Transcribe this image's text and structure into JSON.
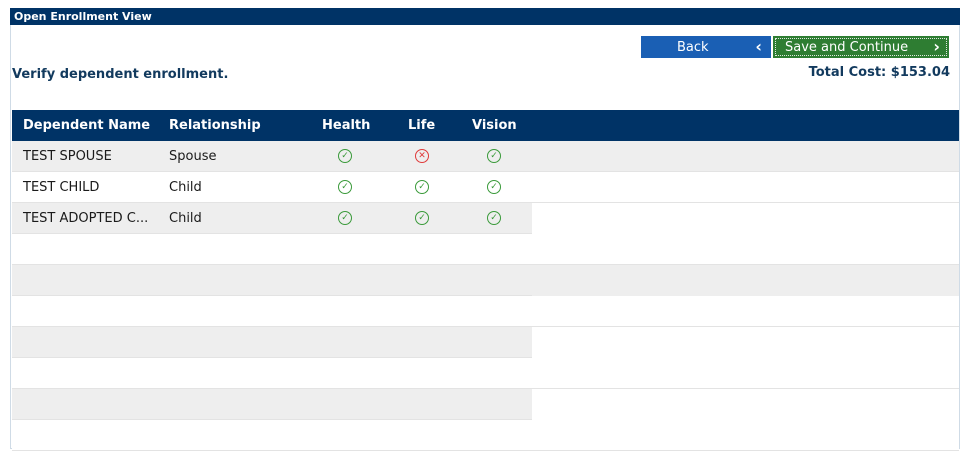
{
  "window": {
    "title": "Open Enrollment View"
  },
  "header": {
    "instruction": "Verify dependent enrollment.",
    "total_cost": "Total Cost: $153.04"
  },
  "buttons": {
    "back_label": "Back",
    "save_label": "Save and Continue"
  },
  "table": {
    "columns": [
      "Dependent Name",
      "Relationship",
      "Health",
      "Life",
      "Vision"
    ],
    "rows": [
      {
        "name": "TEST SPOUSE",
        "relationship": "Spouse",
        "health": "check",
        "life": "x",
        "vision": "check"
      },
      {
        "name": "TEST CHILD",
        "relationship": "Child",
        "health": "check",
        "life": "check",
        "vision": "check"
      },
      {
        "name": "TEST ADOPTED C...",
        "relationship": "Child",
        "health": "check",
        "life": "check",
        "vision": "check"
      }
    ],
    "empty_row_count": 7
  },
  "icons": {
    "check": "check-circle-icon",
    "x": "x-circle-icon",
    "chevron": "chevron-left-icon / chevron-right-icon"
  },
  "colors": {
    "header_bg": "#003366",
    "back_button": "#1a5fb4",
    "save_button": "#2e7d32",
    "enrolled": "#3a9a3a",
    "not_enrolled": "#e03a3a",
    "row_alt": "#eeeeee"
  }
}
